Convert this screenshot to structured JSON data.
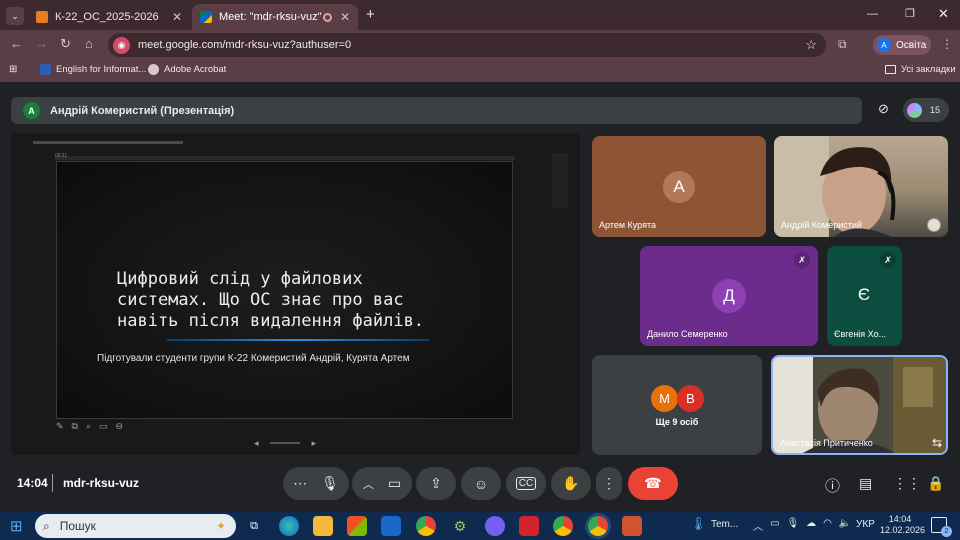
{
  "browser": {
    "tabs": [
      {
        "title": "К-22_ОС_2025-2026",
        "active": false
      },
      {
        "title": "Meet: \"mdr-rksu-vuz\"",
        "active": true
      }
    ],
    "new_tab": "+",
    "url": "meet.google.com/mdr-rksu-vuz?authuser=0",
    "profile_initial": "A",
    "profile_name": "Освіта",
    "bookmarks": [
      "English for Informat...",
      "Adobe Acrobat"
    ],
    "all_bookmarks": "Усі закладки"
  },
  "meet": {
    "presenter_initial": "A",
    "presenter_title": "Андрій Комеристий (Презентація)",
    "participants_count": "15",
    "slide": {
      "title_lines": [
        "Цифровий слід у файлових",
        "системах. Що ОС знає про вас",
        "навіть після видалення файлів."
      ],
      "subtitle": "Підготували студенти групи К-22 Комеристий Андрій, Курята Артем",
      "top_time": "00:11"
    },
    "tiles": [
      {
        "name": "Артем Курята",
        "initial": "А"
      },
      {
        "name": "Андрій Комеристий"
      },
      {
        "name": "Данило Семеренко",
        "initial": "Д"
      },
      {
        "name": "Євгенія Хо...",
        "initial": "Є"
      },
      {
        "more_label": "Ще 9 осіб",
        "initials": [
          "М",
          "В"
        ]
      },
      {
        "name": "Анастасія Притиченко"
      }
    ],
    "time": "14:04",
    "meeting_code": "mdr-rksu-vuz"
  },
  "taskbar": {
    "search_placeholder": "Пошук",
    "weather_label": "Tem...",
    "language": "УКР",
    "clock_time": "14:04",
    "clock_date": "12.02.2026",
    "notif_count": "2"
  },
  "colors": {
    "accent_red": "#ea4335",
    "tile_brown": "#8d5535",
    "tile_purple": "#6c2c8c",
    "tile_teal": "#0b4d3e",
    "tile_grey": "#3c4043"
  }
}
